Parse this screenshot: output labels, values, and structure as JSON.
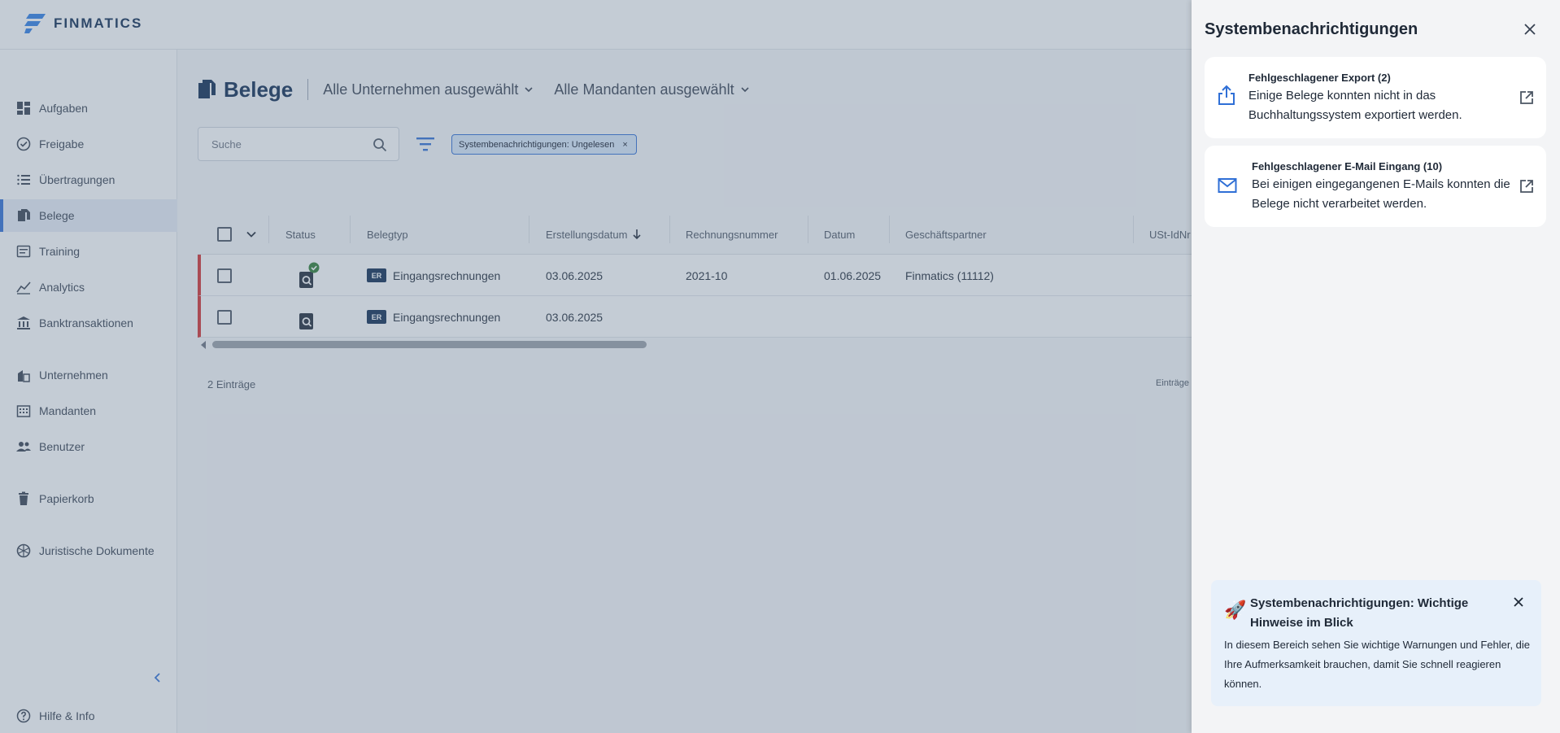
{
  "app": {
    "brand": "FINMATICS"
  },
  "sidebar": {
    "items": [
      {
        "label": "Aufgaben",
        "icon": "dashboard-icon"
      },
      {
        "label": "Freigabe",
        "icon": "check-circle-icon"
      },
      {
        "label": "Übertragungen",
        "icon": "list-icon"
      },
      {
        "label": "Belege",
        "icon": "documents-icon",
        "active": true
      },
      {
        "label": "Training",
        "icon": "training-icon"
      },
      {
        "label": "Analytics",
        "icon": "analytics-icon"
      },
      {
        "label": "Banktransaktionen",
        "icon": "bank-icon"
      },
      {
        "label": "Unternehmen",
        "icon": "company-icon"
      },
      {
        "label": "Mandanten",
        "icon": "clients-icon"
      },
      {
        "label": "Benutzer",
        "icon": "users-icon"
      },
      {
        "label": "Papierkorb",
        "icon": "trash-icon"
      },
      {
        "label": "Juristische Dokumente",
        "icon": "legal-icon"
      }
    ],
    "help_label": "Hilfe & Info"
  },
  "header": {
    "title": "Belege",
    "company_select": "Alle Unternehmen ausgewählt",
    "client_select": "Alle Mandanten ausgewählt"
  },
  "search": {
    "placeholder": "Suche"
  },
  "filter_chip": {
    "label": "Systembenachrichtigungen: Ungelesen",
    "remove": "×"
  },
  "table": {
    "columns": {
      "status": "Status",
      "belegtyp": "Belegtyp",
      "erstellungsdatum": "Erstellungsdatum",
      "rechnungsnummer": "Rechnungsnummer",
      "datum": "Datum",
      "geschaeftspartner": "Geschäftspartner",
      "ust": "USt-IdNr"
    },
    "rows": [
      {
        "badge": "ER",
        "belegtyp": "Eingangsrechnungen",
        "erstellungsdatum": "03.06.2025",
        "rechnungsnummer": "2021-10",
        "datum": "01.06.2025",
        "geschaeftspartner": "Finmatics (11112)",
        "status_checked": true
      },
      {
        "badge": "ER",
        "belegtyp": "Eingangsrechnungen",
        "erstellungsdatum": "03.06.2025",
        "rechnungsnummer": "",
        "datum": "",
        "geschaeftspartner": "",
        "status_checked": false
      }
    ],
    "count": "2 Einträge",
    "entries_label": "Einträge"
  },
  "panel": {
    "title": "Systembenachrichtigungen",
    "notifications": [
      {
        "title": "Fehlgeschlagener Export (2)",
        "text": "Einige Belege konnten nicht in das Buchhaltungssystem exportiert werden.",
        "icon": "share-export-icon"
      },
      {
        "title": "Fehlgeschlagener E-Mail Eingang (10)",
        "text": "Bei einigen eingegangenen E-Mails konnten die Belege nicht verarbeitet werden.",
        "icon": "mail-icon"
      }
    ],
    "tip": {
      "emoji": "🚀",
      "title": "Systembenachrichtigungen: Wichtige Hinweise im Blick",
      "text": "In diesem Bereich sehen Sie wichtige Warnungen und Fehler, die Ihre Aufmerksamkeit brauchen, damit Sie schnell reagieren können."
    }
  },
  "colors": {
    "accent": "#2f6fd6",
    "navy": "#0d2a52",
    "error": "#d32f2f",
    "success": "#2e7d32"
  }
}
